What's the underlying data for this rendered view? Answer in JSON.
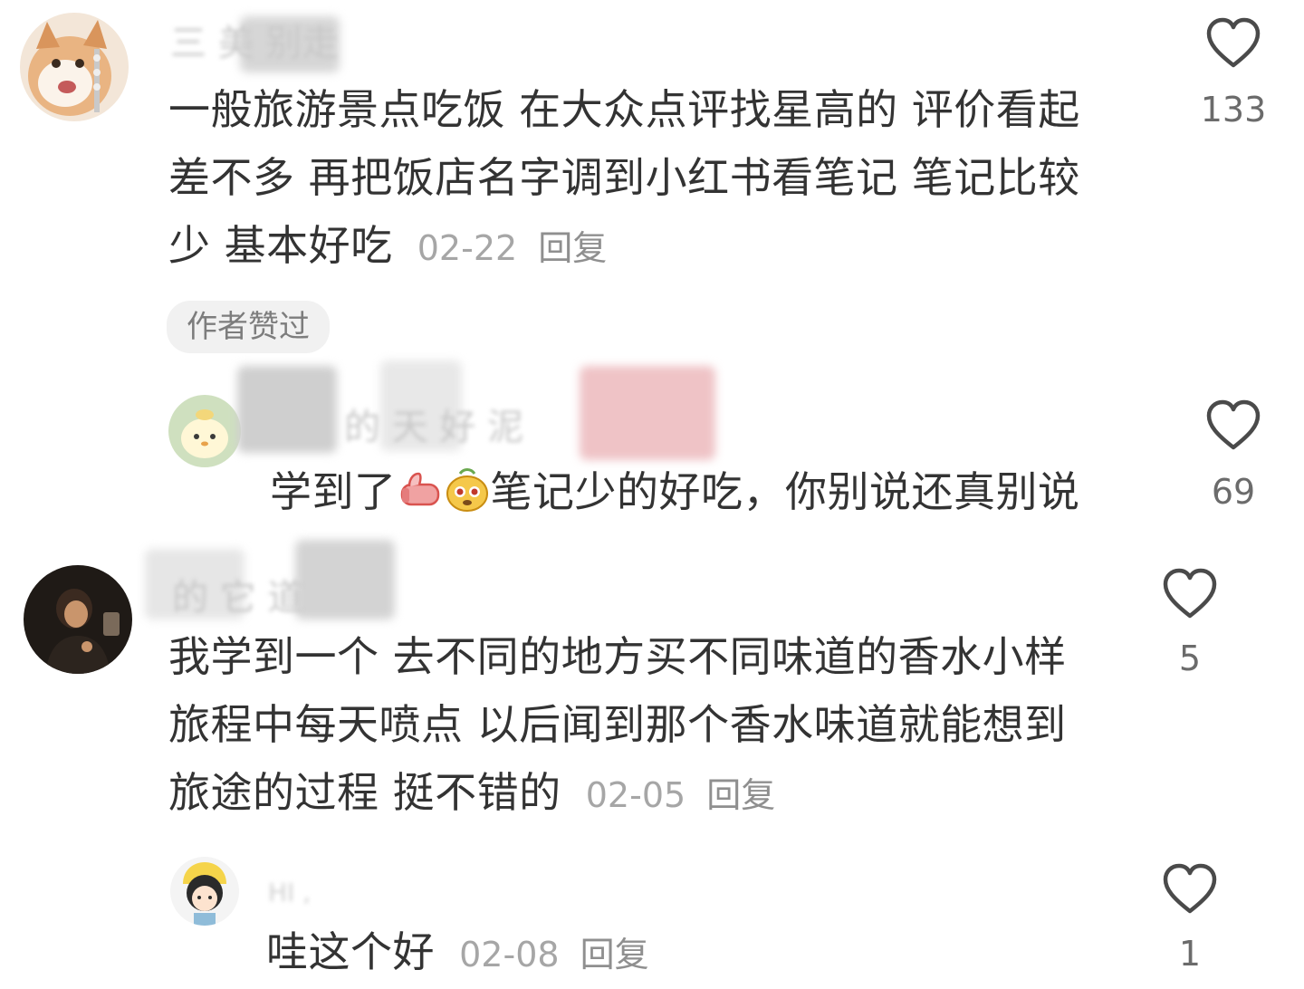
{
  "comments": [
    {
      "user": "三 美 别走",
      "lines": [
        "一般旅游景点吃饭 在大众点评找星高的 评价看起",
        "差不多 再把饭店名字调到小红书看笔记 笔记比较",
        "少 基本好吃"
      ],
      "date": "02-22",
      "reply_label": "回复",
      "likes": "133",
      "badge": "作者赞过"
    },
    {
      "user": "的 天 好 泥",
      "text_before": "学到了",
      "emoji_1": "thumbs-up-emoji",
      "emoji_2": "dog-emoji",
      "text_after": "笔记少的好吃，你别说还真别说",
      "likes": "69"
    },
    {
      "user": "的 它 道",
      "lines": [
        "我学到一个 去不同的地方买不同味道的香水小样",
        "旅程中每天喷点 以后闻到那个香水味道就能想到",
        "旅途的过程 挺不错的"
      ],
      "date": "02-05",
      "reply_label": "回复",
      "likes": "5"
    },
    {
      "user": "HI ,",
      "text": "哇这个好",
      "date": "02-08",
      "reply_label": "回复",
      "likes": "1"
    }
  ],
  "colors": {
    "text": "#333333",
    "meta": "#a6a6a6",
    "like_icon": "#4a4a4a",
    "badge_bg": "#f1f1f1"
  }
}
